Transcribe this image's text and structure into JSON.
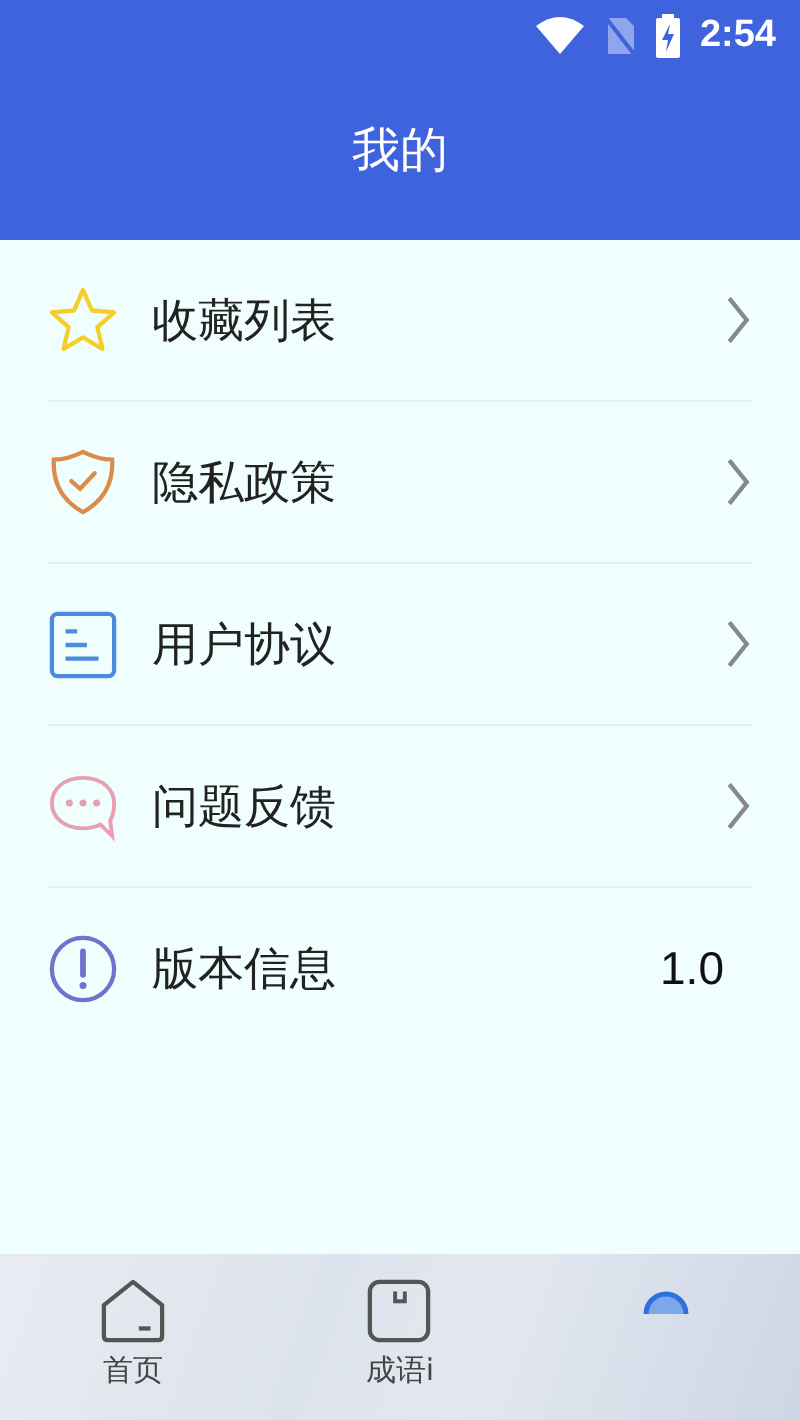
{
  "status_bar": {
    "time": "2:54"
  },
  "header": {
    "title": "我的"
  },
  "menu": [
    {
      "label": "收藏列表",
      "kind": "link"
    },
    {
      "label": "隐私政策",
      "kind": "link"
    },
    {
      "label": "用户协议",
      "kind": "link"
    },
    {
      "label": "问题反馈",
      "kind": "link"
    },
    {
      "label": "版本信息",
      "kind": "value",
      "value": "1.0"
    }
  ],
  "bottom_nav": [
    {
      "label": "首页",
      "selected": false
    },
    {
      "label": "成语i",
      "selected": false
    },
    {
      "selected": true
    }
  ]
}
